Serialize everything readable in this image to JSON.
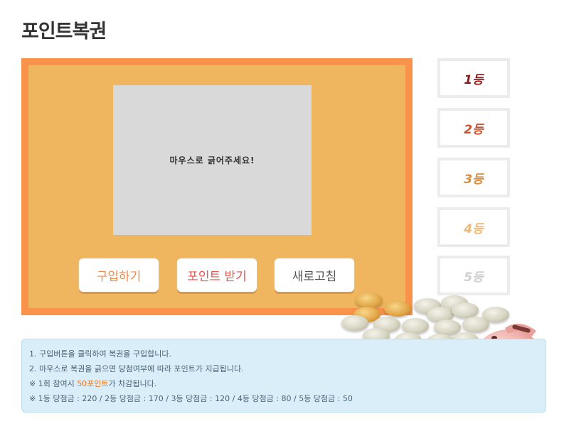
{
  "page": {
    "title": "포인트복권"
  },
  "game": {
    "scratch_text": "마우스로 긁어주세요!",
    "buttons": {
      "buy": "구입하기",
      "get_points": "포인트 받기",
      "refresh": "새로고침"
    },
    "button_colors": {
      "buy": "#f08a4b",
      "get_points": "#e8554a",
      "refresh": "#555555"
    }
  },
  "ranks": [
    {
      "label": "1등",
      "color": "#8b1a1a"
    },
    {
      "label": "2등",
      "color": "#c8502a"
    },
    {
      "label": "3등",
      "color": "#d98a3a"
    },
    {
      "label": "4등",
      "color": "#f0b872"
    },
    {
      "label": "5등",
      "color": "#cfcfcf"
    }
  ],
  "info": {
    "line1": "1. 구입버튼을 클릭하여 복권을 구입합니다.",
    "line2": "2. 마우스로 복권을 긁으면 당첨여부에 따라 포인트가 지급됩니다.",
    "line3_prefix": "※ 1회 참여시 ",
    "line3_highlight": "50포인트",
    "line3_suffix": "가 차감됩니다.",
    "line4": "※ 1등 당첨금 : 220 / 2등 당첨금 : 170 / 3등 당첨금 : 120 / 4등 당첨금 : 80 / 5등 당첨금 : 50"
  },
  "decor": {
    "icons": [
      "coins-image",
      "piggy-bank-image"
    ]
  }
}
